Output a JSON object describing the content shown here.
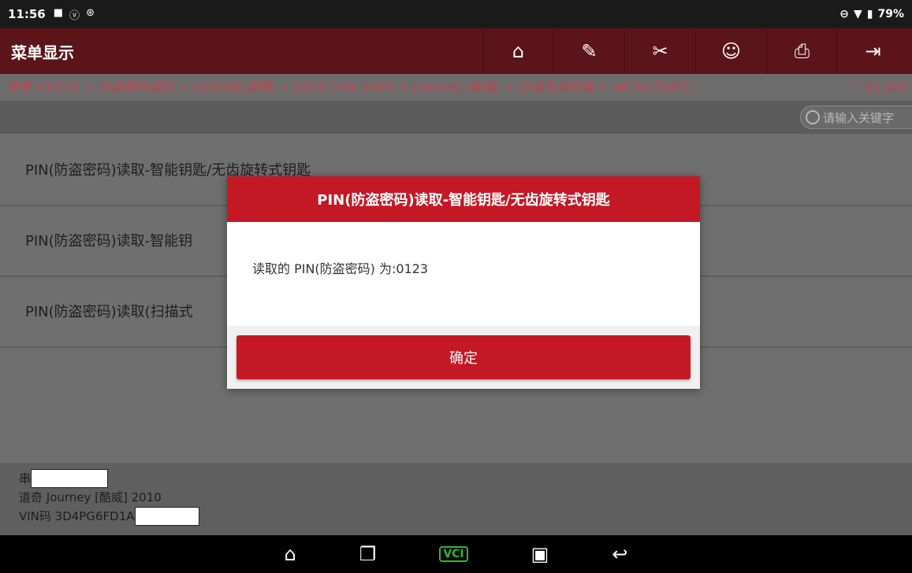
{
  "status_bar": {
    "time": "11:56",
    "icons": [
      "image-icon",
      "vpn-icon",
      "bluetooth-icon"
    ],
    "battery": "79%"
  },
  "header": {
    "title": "菜单显示",
    "toolbar": [
      "home-icon",
      "edit-icon",
      "tools-icon",
      "user-icon",
      "print-icon",
      "exit-icon"
    ]
  },
  "breadcrumb": {
    "text": "道奇 V10.02 > 防盗密码读取 > DODGE(道奇) > 2010 (VIN 10th) > Journey (酷威) > 防盗系统扫描 > WCM(无线控...",
    "voltage": "12.30V"
  },
  "search": {
    "placeholder": "请输入关键字"
  },
  "menu": {
    "items": [
      {
        "label": "PIN(防盗密码)读取-智能钥匙/无齿旋转式钥匙"
      },
      {
        "label": "PIN(防盗密码)读取-智能钥"
      },
      {
        "label": "PIN(防盗密码)读取(扫描式"
      }
    ]
  },
  "vehicle": {
    "label_char": "串",
    "model": "道奇 Journey [酷威] 2010",
    "vin_prefix": "VIN码 3D4PG6FD1A"
  },
  "dialog": {
    "title": "PIN(防盗密码)读取-智能钥匙/无齿旋转式钥匙",
    "message": "读取的 PIN(防盗密码) 为:0123",
    "confirm_label": "确定"
  },
  "nav_bar": {
    "items": [
      "home-outline-icon",
      "recent-apps-icon",
      "vci-icon",
      "gallery-icon",
      "back-icon"
    ],
    "vci_label": "VCI"
  },
  "colors": {
    "header_bg": "#5b141a",
    "accent_red": "#c41925",
    "breadcrumb_text": "#c0454d",
    "vci_green": "#2eb82e"
  }
}
